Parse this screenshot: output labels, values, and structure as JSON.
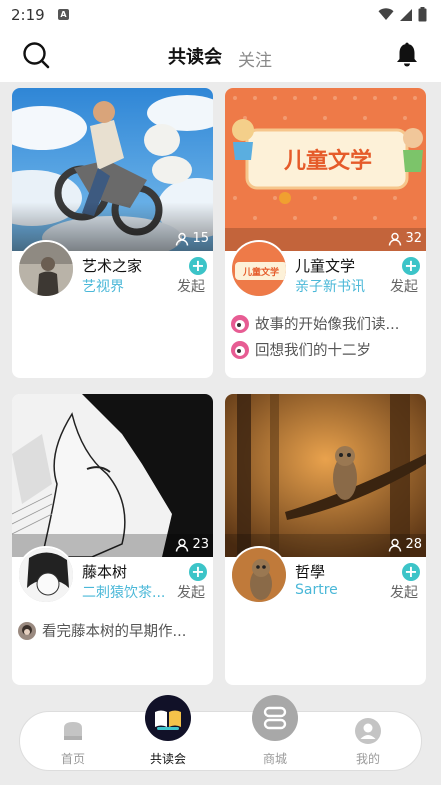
{
  "status_bar": {
    "time": "2:19",
    "notification_badge": "A",
    "icons": [
      "wifi-icon",
      "cell-signal-icon",
      "battery-icon"
    ]
  },
  "header": {
    "tabs": [
      {
        "label": "共读会",
        "active": true
      },
      {
        "label": "关注",
        "active": false
      }
    ],
    "accent": "#40c4cc"
  },
  "cards": [
    {
      "name": "艺术之家",
      "subtitle": "艺视界",
      "members": "15",
      "join_label": "发起",
      "posts": []
    },
    {
      "name": "儿童文学",
      "subtitle": "亲子新书讯",
      "members": "32",
      "join_label": "发起",
      "cover_text": "儿童文学",
      "avatar_text": "儿童文学",
      "posts": [
        "故事的开始像我们读...",
        "回想我们的十二岁"
      ]
    },
    {
      "name": "藤本树",
      "subtitle": "二刺猿饮茶...",
      "members": "23",
      "join_label": "发起",
      "posts": [
        "看完藤本树的早期作..."
      ]
    },
    {
      "name": "哲學",
      "subtitle": "Sartre",
      "members": "28",
      "join_label": "发起",
      "posts": []
    }
  ],
  "bottom_nav": [
    {
      "label": "首页",
      "icon": "home-icon",
      "active": false
    },
    {
      "label": "共读会",
      "icon": "book-icon",
      "active": true
    },
    {
      "label": "商城",
      "icon": "store-icon",
      "active": false
    },
    {
      "label": "我的",
      "icon": "profile-icon",
      "active": false
    }
  ]
}
